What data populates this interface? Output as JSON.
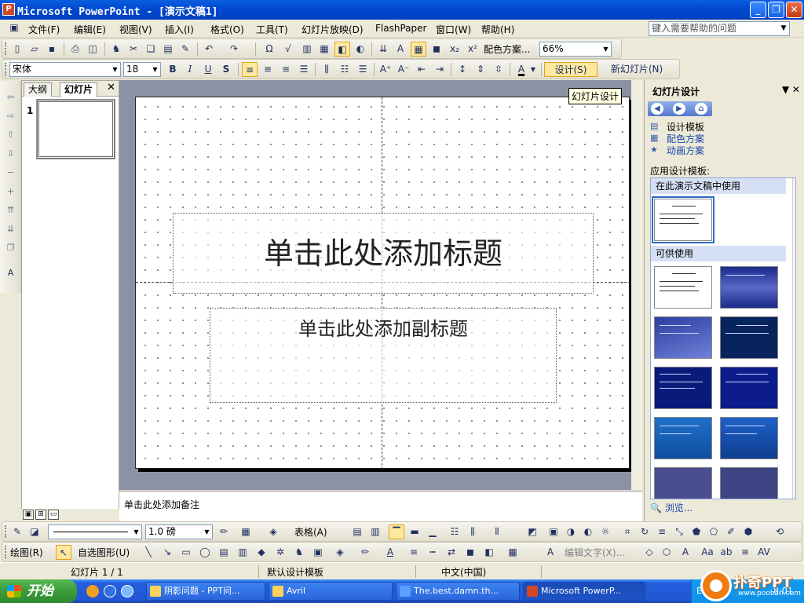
{
  "window": {
    "title": "Microsoft PowerPoint - [演示文稿1]",
    "app_icon": "powerpoint-icon",
    "controls": [
      "minimize",
      "restore",
      "close"
    ]
  },
  "menubar": {
    "items": [
      "文件(F)",
      "编辑(E)",
      "视图(V)",
      "插入(I)",
      "格式(O)",
      "工具(T)",
      "幻灯片放映(D)",
      "FlashPaper",
      "窗口(W)",
      "帮助(H)"
    ],
    "help_placeholder": "键入需要帮助的问题"
  },
  "standard_toolbar": {
    "color_scheme_label": "配色方案...",
    "zoom": "66%"
  },
  "formatting_toolbar": {
    "font": "宋体",
    "size": "18",
    "design_label": "设计(S)",
    "new_slide_label": "新幻灯片(N)"
  },
  "left_pane": {
    "tabs": [
      "大纲",
      "幻灯片"
    ],
    "active_tab": "幻灯片",
    "slide_number": "1"
  },
  "slide": {
    "title_placeholder": "单击此处添加标题",
    "subtitle_placeholder": "单击此处添加副标题"
  },
  "notes": {
    "placeholder": "单击此处添加备注"
  },
  "tooltip": "幻灯片设计",
  "task_pane": {
    "title": "幻灯片设计",
    "links": [
      "设计模板",
      "配色方案",
      "动画方案"
    ],
    "apply_label": "应用设计模板:",
    "section_in_use": "在此演示文稿中使用",
    "section_available": "可供使用",
    "browse": "浏览..."
  },
  "drawing_toolbar": {
    "line_weight": "1.0 磅",
    "table_label": "表格(A)",
    "draw_label": "绘图(R)",
    "autoshape_label": "自选图形(U)",
    "edit_text_label": "编辑文字(X)..."
  },
  "statusbar": {
    "slide": "幻灯片 1 / 1",
    "template": "默认设计模板",
    "language": "中文(中国)"
  },
  "taskbar": {
    "start": "开始",
    "tasks": [
      "阴影问题 - PPT问...",
      "Avril",
      "The.best.damn.th...",
      "Microsoft PowerP..."
    ],
    "tray_lang": "EN",
    "clock": "8:01"
  },
  "watermark": {
    "brand": "扑奇PPT",
    "url": "www.pooban.com"
  },
  "colors": {
    "titlebar": "#0048D0",
    "accent": "#316AC5",
    "start": "#3B9B3A"
  }
}
